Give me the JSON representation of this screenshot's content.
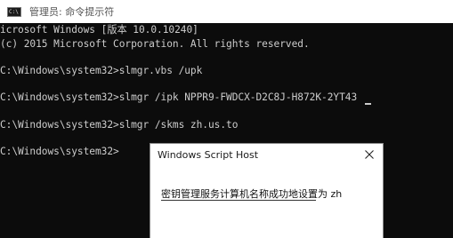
{
  "window": {
    "title": "管理员: 命令提示符",
    "icon": "console-icon"
  },
  "console": {
    "lines": [
      "icrosoft Windows [版本 10.0.10240]",
      "(c) 2015 Microsoft Corporation. All rights reserved.",
      "C:\\Windows\\system32>slmgr.vbs /upk",
      "C:\\Windows\\system32>slmgr /ipk NPPR9-FWDCX-D2C8J-H872K-2YT43",
      "C:\\Windows\\system32>slmgr /skms zh.us.to",
      "C:\\Windows\\system32>"
    ]
  },
  "dialog": {
    "title": "Windows Script Host",
    "message": "密钥管理服务计算机名称成功地设置为 zh",
    "close_icon": "close-icon"
  }
}
